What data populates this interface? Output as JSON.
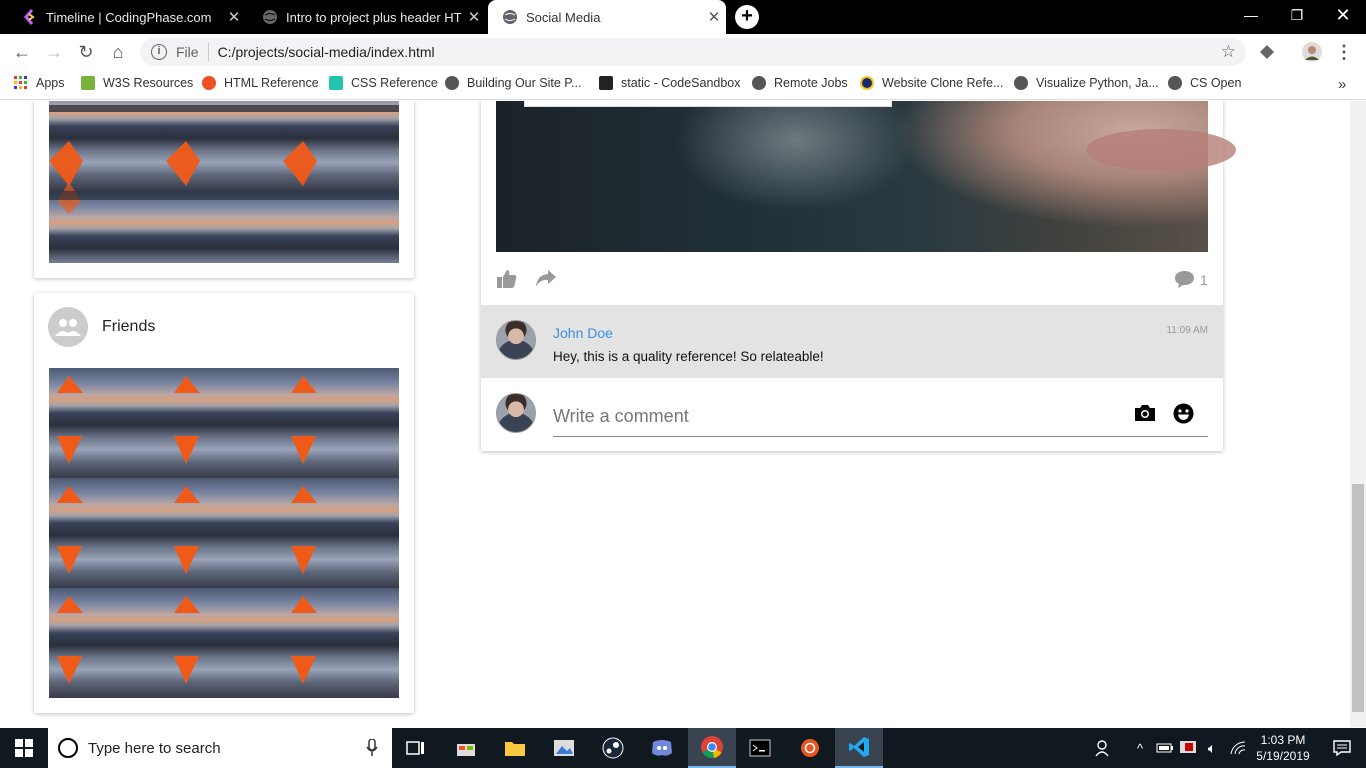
{
  "browser": {
    "tabs": [
      {
        "title": "Timeline | CodingPhase.com",
        "active": false
      },
      {
        "title": "Intro to project plus header HTM",
        "active": false
      },
      {
        "title": "Social Media",
        "active": true
      }
    ],
    "omnibox": {
      "scheme_label": "File",
      "url": "C:/projects/social-media/index.html"
    },
    "bookmarks": [
      "Apps",
      "W3S Resources",
      "HTML Reference",
      "CSS Reference",
      "Building Our Site P...",
      "static - CodeSandbox",
      "Remote Jobs",
      "Website Clone Refe...",
      "Visualize Python, Ja...",
      "CS Open"
    ]
  },
  "page": {
    "friends": {
      "title": "Friends"
    },
    "post": {
      "comment_count": "1",
      "comment": {
        "author": "John Doe",
        "text": "Hey, this is a quality reference! So relateable!",
        "time": "11:09 AM"
      },
      "write_placeholder": "Write a comment"
    }
  },
  "taskbar": {
    "search_placeholder": "Type here to search",
    "time": "1:03 PM",
    "date": "5/19/2019"
  },
  "colors": {
    "accent_link": "#3d8fe3",
    "comment_bg": "#e3e3e3"
  }
}
